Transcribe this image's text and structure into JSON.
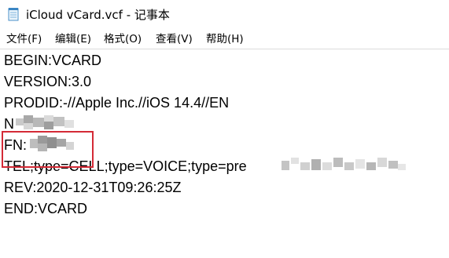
{
  "window": {
    "title": "iCloud vCard.vcf - 记事本",
    "icon": "notepad-icon"
  },
  "menu": {
    "items": [
      "文件(F)",
      "编辑(E)",
      "格式(O)",
      "查看(V)",
      "帮助(H)"
    ]
  },
  "document": {
    "lines": [
      "BEGIN:VCARD",
      "VERSION:3.0",
      "PRODID:-//Apple Inc.//iOS 14.4//EN",
      "N",
      "FN:",
      "TEL;type=CELL;type=VOICE;type=pre",
      "REV:2020-12-31T09:26:25Z",
      "END:VCARD"
    ]
  },
  "annotation": {
    "highlight_color": "#d42a36"
  },
  "colors": {
    "background": "#ffffff",
    "text": "#000000"
  }
}
